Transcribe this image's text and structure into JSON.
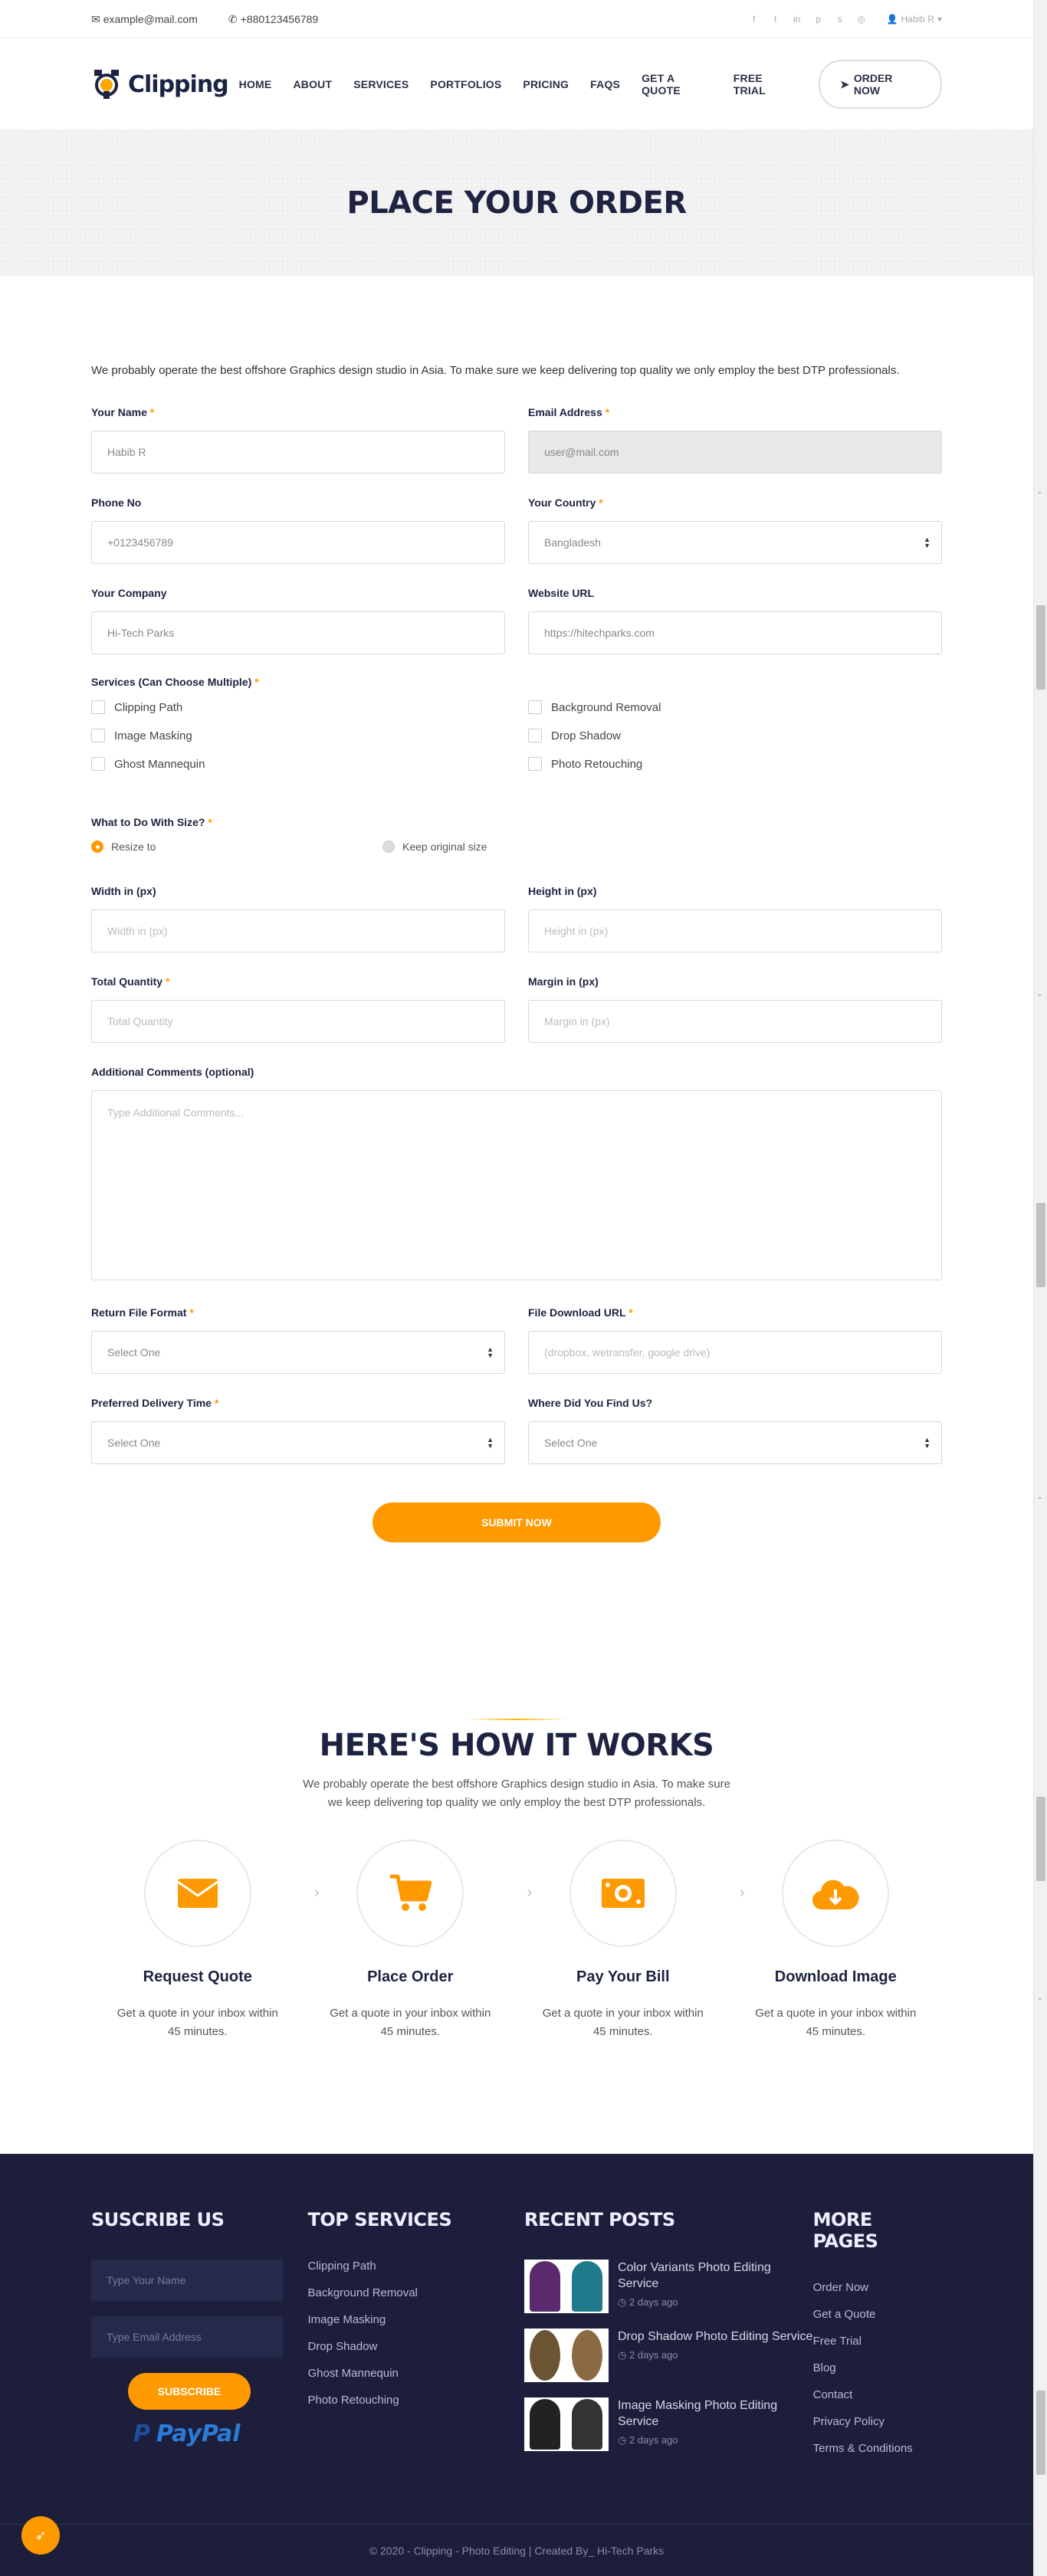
{
  "topbar": {
    "email": "example@mail.com",
    "phone": "+880123456789",
    "user": "Habib R"
  },
  "brand": {
    "name": "Clipping",
    "accent": "#ff9900",
    "dark": "#1d2341"
  },
  "nav": [
    "HOME",
    "ABOUT",
    "SERVICES",
    "PORTFOLIOS",
    "PRICING",
    "FAQS",
    "GET A QUOTE",
    "FREE TRIAL"
  ],
  "order_now": "ORDER NOW",
  "hero_title": "PLACE YOUR ORDER",
  "form": {
    "intro": "We probably operate the best offshore Graphics design studio in Asia. To make sure we keep delivering top quality we only employ the best DTP professionals.",
    "name_label": "Your Name",
    "name_value": "Habib R",
    "email_label": "Email Address",
    "email_value": "user@mail.com",
    "phone_label": "Phone No",
    "phone_value": "+0123456789",
    "country_label": "Your Country",
    "country_value": "Bangladesh",
    "company_label": "Your Company",
    "company_value": "Hi-Tech Parks",
    "website_label": "Website URL",
    "website_value": "https://hitechparks.com",
    "services_label": "Services (Can Choose Multiple)",
    "services": [
      "Clipping Path",
      "Image Masking",
      "Ghost Mannequin",
      "Background Removal",
      "Drop Shadow",
      "Photo Retouching"
    ],
    "size_label": "What to Do With Size?",
    "size_options": [
      "Resize to",
      "Keep original size"
    ],
    "width_label": "Width in (px)",
    "width_ph": "Width in (px)",
    "height_label": "Height in (px)",
    "height_ph": "Height in (px)",
    "qty_label": "Total Quantity",
    "qty_ph": "Total Quantity",
    "margin_label": "Margin in (px)",
    "margin_ph": "Margin in (px)",
    "comments_label": "Additional Comments (optional)",
    "comments_ph": "Type Additional Comments...",
    "format_label": "Return File Format",
    "format_value": "Select One",
    "download_label": "File Download URL",
    "download_ph": "(dropbox, wetransfer, google drive)",
    "delivery_label": "Preferred Delivery Time",
    "delivery_value": "Select One",
    "find_label": "Where Did You Find Us?",
    "find_value": "Select One",
    "submit": "SUBMIT NOW"
  },
  "how": {
    "title": "HERE'S HOW IT WORKS",
    "subtitle": "We probably operate the best offshore Graphics design studio in Asia. To make sure we keep delivering top quality we only employ the best DTP professionals.",
    "steps": [
      {
        "title": "Request Quote",
        "text": "Get a quote in your inbox within 45 minutes.",
        "icon": "envelope-icon"
      },
      {
        "title": "Place Order",
        "text": "Get a quote in your inbox within 45 minutes.",
        "icon": "cart-icon"
      },
      {
        "title": "Pay Your Bill",
        "text": "Get a quote in your inbox within 45 minutes.",
        "icon": "money-icon"
      },
      {
        "title": "Download Image",
        "text": "Get a quote in your inbox within 45 minutes.",
        "icon": "cloud-download-icon"
      }
    ]
  },
  "footer": {
    "subscribe_title": "SUSCRIBE US",
    "name_ph": "Type Your Name",
    "email_ph": "Type Email Address",
    "subscribe_btn": "SUBSCRIBE",
    "paypal": "PayPal",
    "services_title": "TOP SERVICES",
    "services": [
      "Clipping Path",
      "Background Removal",
      "Image Masking",
      "Drop Shadow",
      "Ghost Mannequin",
      "Photo Retouching"
    ],
    "posts_title": "RECENT POSTS",
    "posts": [
      {
        "title": "Color Variants Photo Editing Service",
        "date": "2 days ago"
      },
      {
        "title": "Drop Shadow Photo Editing Service",
        "date": "2 days ago"
      },
      {
        "title": "Image Masking Photo Editing Service",
        "date": "2 days ago"
      }
    ],
    "pages_title": "MORE PAGES",
    "pages": [
      "Order Now",
      "Get a Quote",
      "Free Trial",
      "Blog",
      "Contact",
      "Privacy Policy",
      "Terms & Conditions"
    ],
    "copyright": "© 2020 - Clipping - Photo Editing | Created By_ Hi-Tech Parks"
  }
}
